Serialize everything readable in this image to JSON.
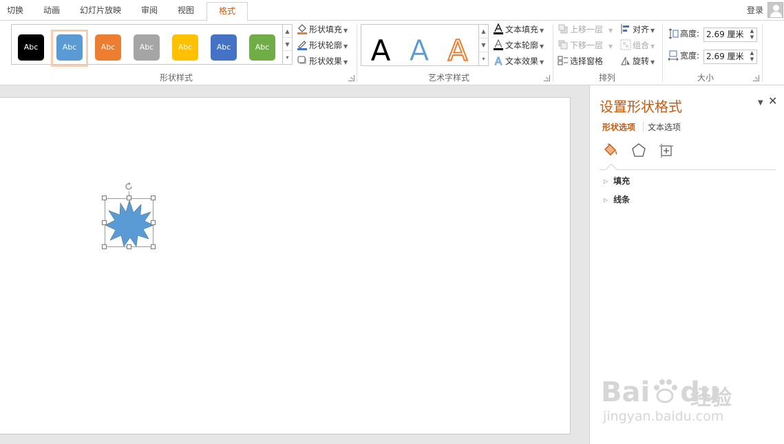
{
  "tabs": [
    {
      "label": "切换"
    },
    {
      "label": "动画"
    },
    {
      "label": "幻灯片放映"
    },
    {
      "label": "审阅"
    },
    {
      "label": "视图"
    },
    {
      "label": "格式"
    }
  ],
  "active_tab": "格式",
  "account": {
    "login_label": "登录",
    "avatar_icon": "user-avatar-icon"
  },
  "ribbon": {
    "shape_styles": {
      "group_label": "形状样式",
      "swatches": [
        {
          "label": "Abc",
          "color": "#000000"
        },
        {
          "label": "Abc",
          "color": "#5b9bd5"
        },
        {
          "label": "Abc",
          "color": "#ed7d31"
        },
        {
          "label": "Abc",
          "color": "#a5a5a5"
        },
        {
          "label": "Abc",
          "color": "#ffc000"
        },
        {
          "label": "Abc",
          "color": "#4472c4"
        },
        {
          "label": "Abc",
          "color": "#70ad47"
        }
      ],
      "selected_index": 1,
      "fill_label": "形状填充",
      "outline_label": "形状轮廓",
      "effects_label": "形状效果"
    },
    "wordart": {
      "group_label": "艺术字样式",
      "samples": [
        {
          "label": "A",
          "color": "#000000"
        },
        {
          "label": "A",
          "color": "#5b9bd5"
        },
        {
          "label": "A",
          "color": "#ed7d31"
        }
      ],
      "text_fill_label": "文本填充",
      "text_outline_label": "文本轮廓",
      "text_effects_label": "文本效果"
    },
    "arrange": {
      "group_label": "排列",
      "bring_forward_label": "上移一层",
      "send_backward_label": "下移一层",
      "selection_pane_label": "选择窗格",
      "align_label": "对齐",
      "group_cmd_label": "组合",
      "rotate_label": "旋转"
    },
    "size": {
      "group_label": "大小",
      "height_label": "高度:",
      "height_value": "2.69 厘米",
      "width_label": "宽度:",
      "width_value": "2.69 厘米"
    }
  },
  "slide": {
    "shape_name": "explosion-star-shape",
    "shape_color": "#5b9bd5"
  },
  "pane": {
    "title": "设置形状格式",
    "tab_shape_options": "形状选项",
    "tab_text_options": "文本选项",
    "sections": [
      {
        "label": "填充"
      },
      {
        "label": "线条"
      }
    ],
    "accent_color": "#c55a11"
  },
  "watermark": {
    "brand": "Bai",
    "brand_tail": "du",
    "cn": "经验",
    "url": "jingyan.baidu.com"
  }
}
